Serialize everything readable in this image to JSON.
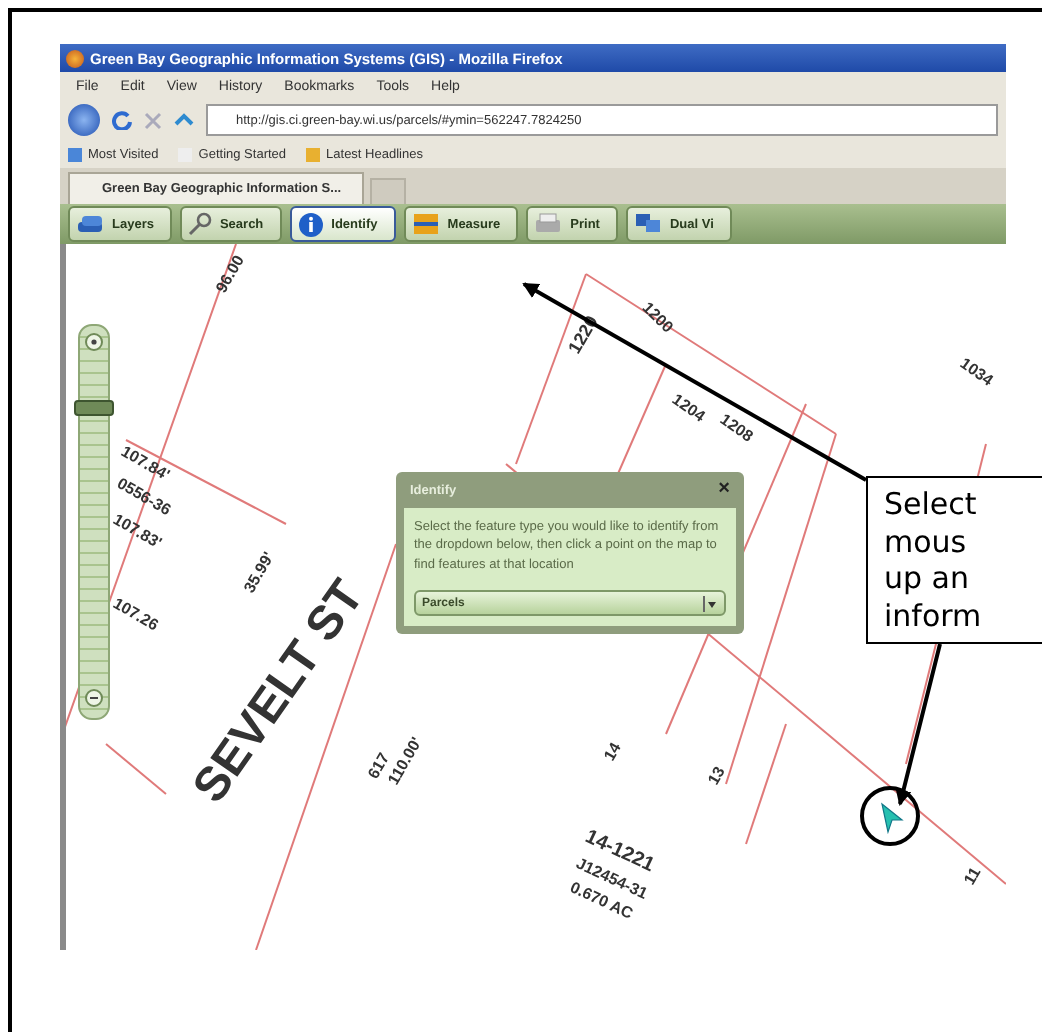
{
  "window": {
    "title": "Green Bay Geographic Information Systems (GIS) - Mozilla Firefox"
  },
  "menu": [
    "File",
    "Edit",
    "View",
    "History",
    "Bookmarks",
    "Tools",
    "Help"
  ],
  "address": {
    "value": "http://gis.ci.green-bay.wi.us/parcels/#ymin=562247.7824250"
  },
  "bookmarks": [
    "Most Visited",
    "Getting Started",
    "Latest Headlines"
  ],
  "tabs": [
    {
      "label": "Green Bay Geographic Information S...",
      "selected": true
    }
  ],
  "toolbar": [
    {
      "label": "Layers",
      "selected": false
    },
    {
      "label": "Search",
      "selected": false
    },
    {
      "label": "Identify",
      "selected": true
    },
    {
      "label": "Measure",
      "selected": false
    },
    {
      "label": "Print",
      "selected": false
    },
    {
      "label": "Dual Vi",
      "selected": false
    }
  ],
  "zoom_slider": {
    "level": 0.85
  },
  "map_labels": [
    "96.00",
    "107.84'",
    "0556-36",
    "107.83'",
    "107.26",
    "35.99'",
    "SEVELT ST",
    "617",
    "110.00'",
    "14-1221",
    "J12454-31",
    "0.670 AC",
    "1200",
    "1220",
    "1204",
    "1208",
    "1034",
    "14",
    "13",
    "11"
  ],
  "identify_panel": {
    "title": "Identify",
    "close": "×",
    "text": "Select the feature type you would like to identify from the dropdown below, then click a point on the map to find features at that location",
    "dropdown": {
      "value": "Parcels"
    }
  },
  "callout": {
    "lines": [
      "Select",
      "mous",
      "up an",
      "inform"
    ]
  }
}
